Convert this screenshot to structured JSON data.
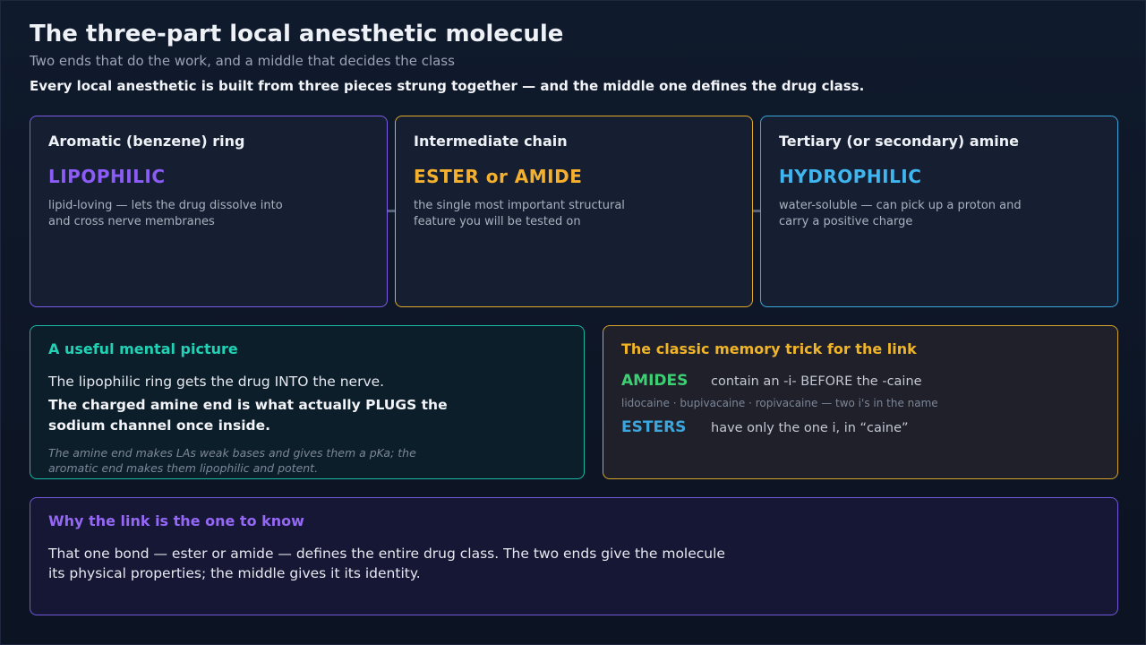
{
  "header": {
    "title": "The three-part local anesthetic molecule",
    "subtitle": "Two ends that do the work, and a middle that decides the class",
    "lead": "Every local anesthetic is built from three pieces strung together — and the middle one defines the drug class."
  },
  "parts": [
    {
      "name": "Aromatic (benzene) ring",
      "property": "LIPOPHILIC",
      "description": "lipid-loving — lets the drug dissolve into and cross nerve membranes",
      "color": "#8b5cf6"
    },
    {
      "name": "Intermediate chain",
      "property": "ESTER or AMIDE",
      "description": "the single most important structural feature you will be tested on",
      "color": "#f5b02e"
    },
    {
      "name": "Tertiary (or secondary) amine",
      "property": "HYDROPHILIC",
      "description": "water-soluble — can pick up a proton and carry a positive charge",
      "color": "#3fb6f0"
    }
  ],
  "mental_picture": {
    "heading": "A useful mental picture",
    "line1": "The lipophilic ring gets the drug INTO the nerve.",
    "line2": "The charged amine end is what actually PLUGS the sodium channel once inside.",
    "note": "The amine end makes LAs weak bases and gives them a pKa; the aromatic end makes them lipophilic and potent."
  },
  "memory_trick": {
    "heading": "The classic memory trick for the link",
    "amides_label": "AMIDES",
    "amides_text": "contain an -i- BEFORE the -caine",
    "amides_examples": "lidocaine · bupivacaine · ropivacaine — two i's in the name",
    "esters_label": "ESTERS",
    "esters_text": "have only the one i, in “caine”"
  },
  "why_link": {
    "heading": "Why the link is the one to know",
    "text": "That one bond — ester or amide — defines the entire drug class. The two ends give the molecule its physical properties; the middle gives it its identity."
  }
}
